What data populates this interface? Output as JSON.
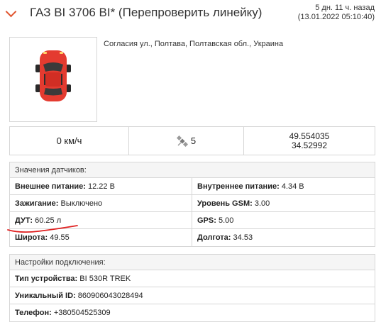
{
  "header": {
    "title": "ГАЗ ВІ 3706 ВІ* (Перепроверить линейку)",
    "time_ago": "5 дн. 11 ч. назад",
    "timestamp": "(13.01.2022 05:10:40)"
  },
  "location": {
    "address": "Согласия ул., Полтава, Полтавская обл., Украина"
  },
  "stats": {
    "speed": "0 км/ч",
    "satellites": "5",
    "lat": "49.554035",
    "lon": "34.52992"
  },
  "sensors": {
    "title": "Значения датчиков:",
    "rows": [
      [
        {
          "label": "Внешнее питание:",
          "value": "12.22 В"
        },
        {
          "label": "Внутреннее питание:",
          "value": "4.34 В"
        }
      ],
      [
        {
          "label": "Зажигание:",
          "value": "Выключено"
        },
        {
          "label": "Уровень GSM:",
          "value": "3.00"
        }
      ],
      [
        {
          "label": "ДУТ:",
          "value": "60.25 л"
        },
        {
          "label": "GPS:",
          "value": "5.00"
        }
      ],
      [
        {
          "label": "Широта:",
          "value": "49.55"
        },
        {
          "label": "Долгота:",
          "value": "34.53"
        }
      ]
    ]
  },
  "connection": {
    "title": "Настройки подключения:",
    "rows": [
      {
        "label": "Тип устройства:",
        "value": "BI 530R TREK"
      },
      {
        "label": "Уникальный ID:",
        "value": "860906043028494"
      },
      {
        "label": "Телефон:",
        "value": "+380504525309"
      }
    ]
  },
  "colors": {
    "accent": "#e0532c",
    "car_body": "#e43b30",
    "border": "#d6d6d6",
    "annotation": "#e02020"
  },
  "icons": {
    "back": "chevron-right-icon",
    "car": "car-top-view-icon",
    "satellite": "satellite-icon"
  }
}
